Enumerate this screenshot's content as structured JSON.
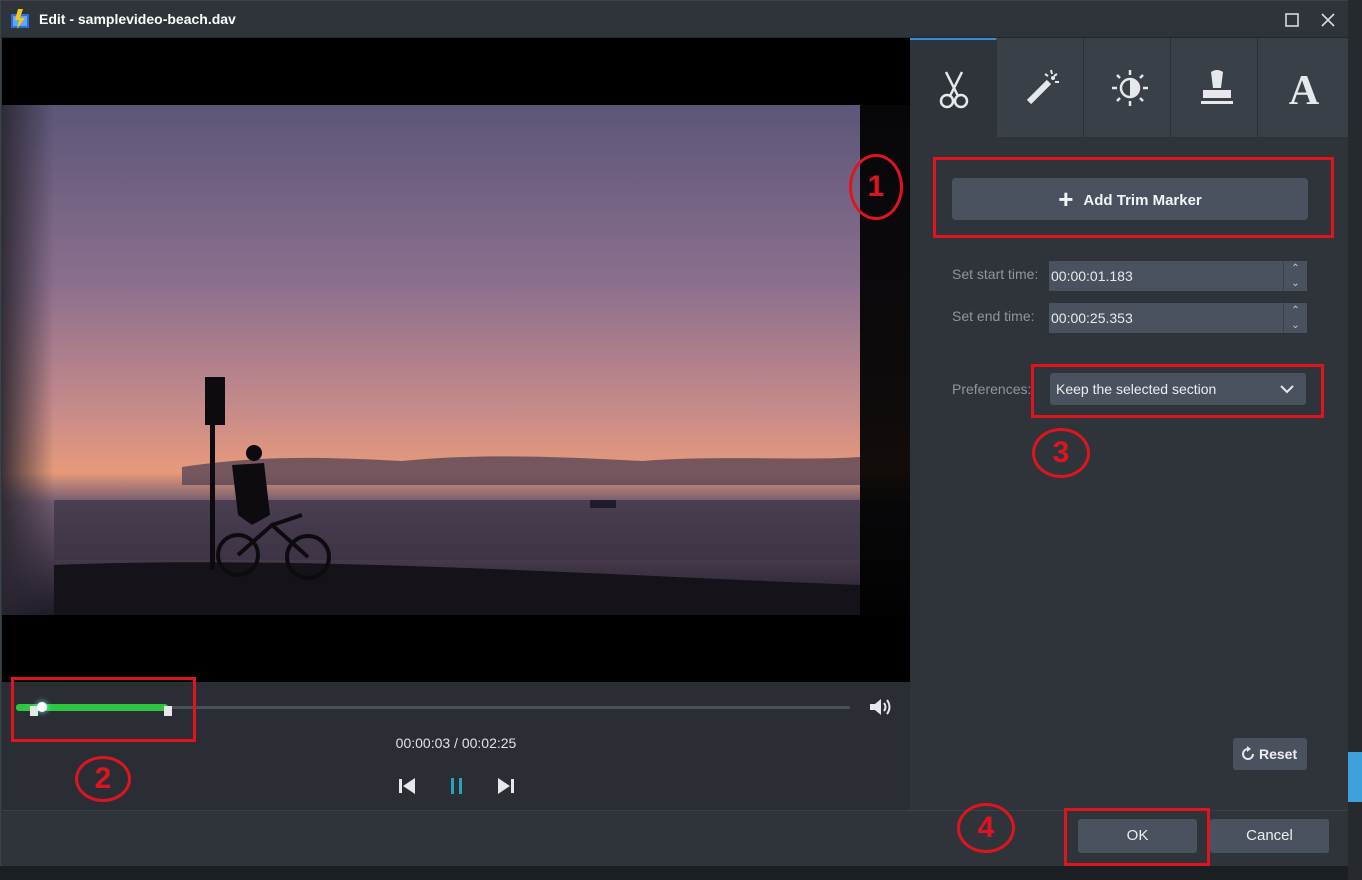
{
  "window": {
    "title": "Edit - samplevideo-beach.dav"
  },
  "player": {
    "current_time": "00:00:03",
    "separator": " / ",
    "total_time": "00:02:25",
    "progress_fraction": 0.02,
    "selection_start_fraction": 0.008,
    "selection_end_fraction": 0.175
  },
  "panel": {
    "tabs": [
      {
        "icon": "scissors-icon",
        "active": true
      },
      {
        "icon": "magic-wand-icon",
        "active": false
      },
      {
        "icon": "brightness-icon",
        "active": false
      },
      {
        "icon": "stamp-icon",
        "active": false
      },
      {
        "icon": "text-icon",
        "active": false
      }
    ],
    "add_trim_marker": "Add Trim Marker",
    "start_label": "Set start time:",
    "start_value": "00:00:01.183",
    "end_label": "Set end time:",
    "end_value": "00:00:25.353",
    "preferences_label": "Preferences:",
    "preferences_value": "Keep the selected section",
    "reset_label": "Reset"
  },
  "footer": {
    "ok_label": "OK",
    "cancel_label": "Cancel"
  },
  "annotations": [
    "1",
    "2",
    "3",
    "4"
  ],
  "colors": {
    "accent": "#2f8fdd",
    "selection": "#2ec640",
    "annotation": "#e0141e"
  }
}
